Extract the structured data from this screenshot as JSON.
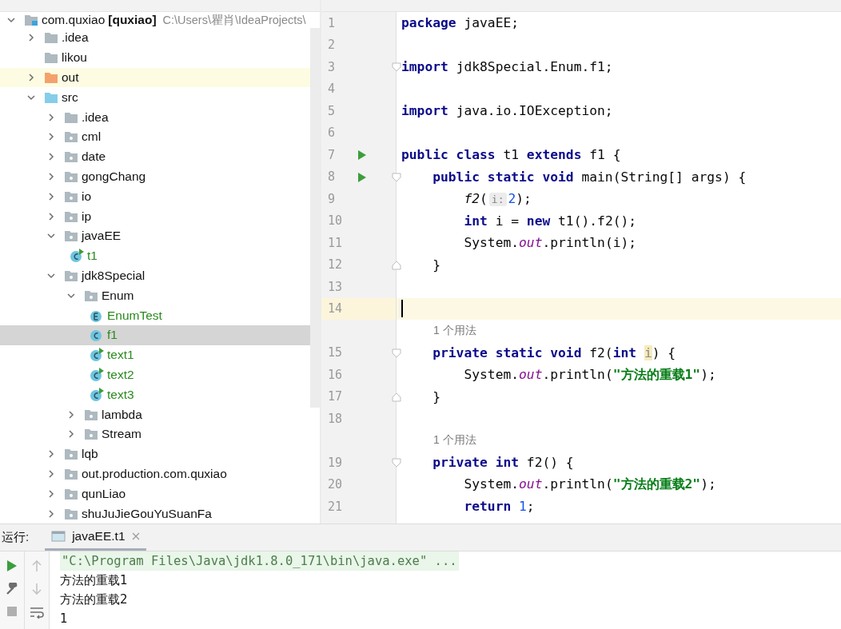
{
  "project_tree": {
    "root": {
      "name": "com.quxiao",
      "module": "[quxiao]",
      "path": "C:\\Users\\瞿肖\\IdeaProjects\\",
      "expanded": true
    },
    "items": [
      {
        "name": ".idea",
        "kind": "folder",
        "expanded": false,
        "selected": false,
        "highlighted": false
      },
      {
        "name": "likou",
        "kind": "plain_folder",
        "selected": false,
        "highlighted": false
      },
      {
        "name": "out",
        "kind": "excluded_folder",
        "expanded": false,
        "selected": false,
        "highlighted": true
      },
      {
        "name": "src",
        "kind": "source_root",
        "expanded": true,
        "selected": false,
        "highlighted": false,
        "children": [
          {
            "name": ".idea",
            "kind": "folder",
            "expanded": false,
            "selected": false,
            "highlighted": false
          },
          {
            "name": "cml",
            "kind": "package",
            "expanded": false,
            "selected": false,
            "highlighted": false
          },
          {
            "name": "date",
            "kind": "package",
            "expanded": false,
            "selected": false,
            "highlighted": false
          },
          {
            "name": "gongChang",
            "kind": "package",
            "expanded": false,
            "selected": false,
            "highlighted": false
          },
          {
            "name": "io",
            "kind": "package",
            "expanded": false,
            "selected": false,
            "highlighted": false
          },
          {
            "name": "ip",
            "kind": "package",
            "expanded": false,
            "selected": false,
            "highlighted": false
          },
          {
            "name": "javaEE",
            "kind": "package",
            "expanded": true,
            "selected": false,
            "highlighted": false,
            "children": [
              {
                "name": "t1",
                "kind": "main_class",
                "selected": false,
                "highlighted": false
              }
            ]
          },
          {
            "name": "jdk8Special",
            "kind": "package",
            "expanded": true,
            "selected": false,
            "highlighted": false,
            "children": [
              {
                "name": "Enum",
                "kind": "package",
                "expanded": true,
                "selected": false,
                "highlighted": false,
                "children": [
                  {
                    "name": "EnumTest",
                    "kind": "enum",
                    "selected": false,
                    "highlighted": false
                  },
                  {
                    "name": "f1",
                    "kind": "class",
                    "selected": true,
                    "highlighted": false
                  },
                  {
                    "name": "text1",
                    "kind": "main_class",
                    "selected": false,
                    "highlighted": false
                  },
                  {
                    "name": "text2",
                    "kind": "main_class",
                    "selected": false,
                    "highlighted": false
                  },
                  {
                    "name": "text3",
                    "kind": "main_class",
                    "selected": false,
                    "highlighted": false
                  }
                ]
              },
              {
                "name": "lambda",
                "kind": "package",
                "expanded": false,
                "selected": false,
                "highlighted": false
              },
              {
                "name": "Stream",
                "kind": "package",
                "expanded": false,
                "selected": false,
                "highlighted": false
              }
            ]
          },
          {
            "name": "lqb",
            "kind": "package",
            "expanded": false,
            "selected": false,
            "highlighted": false
          },
          {
            "name": "out.production.com.quxiao",
            "kind": "package",
            "expanded": false,
            "selected": false,
            "highlighted": false
          },
          {
            "name": "qunLiao",
            "kind": "package",
            "expanded": false,
            "selected": false,
            "highlighted": false
          },
          {
            "name": "shuJuJieGouYuSuanFa",
            "kind": "package",
            "expanded": false,
            "selected": false,
            "highlighted": false
          }
        ]
      }
    ]
  },
  "editor": {
    "rows": [
      {
        "kind": "code",
        "number": "1",
        "current": false,
        "run": false,
        "fold_start": false,
        "fold_end": false,
        "tokens": [
          {
            "kind": "kw",
            "s": "package"
          },
          {
            "kind": "plain",
            "s": " javaEE;"
          }
        ]
      },
      {
        "kind": "code",
        "number": "2",
        "current": false,
        "run": false,
        "fold_start": false,
        "fold_end": false,
        "tokens": []
      },
      {
        "kind": "code",
        "number": "3",
        "current": false,
        "run": false,
        "fold_start": true,
        "fold_end": false,
        "tokens": [
          {
            "kind": "kw",
            "s": "import"
          },
          {
            "kind": "plain",
            "s": " jdk8Special.Enum.f1;"
          }
        ]
      },
      {
        "kind": "code",
        "number": "4",
        "current": false,
        "run": false,
        "fold_start": false,
        "fold_end": false,
        "tokens": []
      },
      {
        "kind": "code",
        "number": "5",
        "current": false,
        "run": false,
        "fold_start": false,
        "fold_end": false,
        "tokens": [
          {
            "kind": "kw",
            "s": "import"
          },
          {
            "kind": "plain",
            "s": " java.io.IOException;"
          }
        ]
      },
      {
        "kind": "code",
        "number": "6",
        "current": false,
        "run": false,
        "fold_start": false,
        "fold_end": false,
        "tokens": []
      },
      {
        "kind": "code",
        "number": "7",
        "current": false,
        "run": true,
        "fold_start": false,
        "fold_end": false,
        "tokens": [
          {
            "kind": "kw",
            "s": "public class"
          },
          {
            "kind": "plain",
            "s": " t1 "
          },
          {
            "kind": "kw",
            "s": "extends"
          },
          {
            "kind": "plain",
            "s": " f1 {"
          }
        ]
      },
      {
        "kind": "code",
        "number": "8",
        "current": false,
        "run": true,
        "fold_start": true,
        "fold_end": false,
        "tokens": [
          {
            "kind": "kw",
            "s": "    public static void"
          },
          {
            "kind": "plain",
            "s": " main(String[] args) {"
          }
        ]
      },
      {
        "kind": "code",
        "number": "9",
        "current": false,
        "run": false,
        "fold_start": false,
        "fold_end": false,
        "tokens": [
          {
            "kind": "call",
            "s": "        f2"
          },
          {
            "kind": "plain",
            "s": "("
          },
          {
            "kind": "hint",
            "s": "i:"
          },
          {
            "kind": "num",
            "s": "2"
          },
          {
            "kind": "plain",
            "s": ");"
          }
        ]
      },
      {
        "kind": "code",
        "number": "10",
        "current": false,
        "run": false,
        "fold_start": false,
        "fold_end": false,
        "tokens": [
          {
            "kind": "kw",
            "s": "        int"
          },
          {
            "kind": "plain",
            "s": " i = "
          },
          {
            "kind": "kw",
            "s": "new"
          },
          {
            "kind": "plain",
            "s": " t1().f2();"
          }
        ]
      },
      {
        "kind": "code",
        "number": "11",
        "current": false,
        "run": false,
        "fold_start": false,
        "fold_end": false,
        "tokens": [
          {
            "kind": "plain",
            "s": "        System."
          },
          {
            "kind": "field",
            "s": "out"
          },
          {
            "kind": "plain",
            "s": ".println(i);"
          }
        ]
      },
      {
        "kind": "code",
        "number": "12",
        "current": false,
        "run": false,
        "fold_start": false,
        "fold_end": true,
        "tokens": [
          {
            "kind": "plain",
            "s": "    }"
          }
        ]
      },
      {
        "kind": "code",
        "number": "13",
        "current": false,
        "run": false,
        "fold_start": false,
        "fold_end": false,
        "tokens": []
      },
      {
        "kind": "code",
        "number": "14",
        "current": true,
        "run": false,
        "fold_start": false,
        "fold_end": false,
        "tokens": []
      },
      {
        "kind": "hint",
        "text": "1 个用法"
      },
      {
        "kind": "code",
        "number": "15",
        "current": false,
        "run": false,
        "fold_start": true,
        "fold_end": false,
        "tokens": [
          {
            "kind": "kw",
            "s": "    private static void"
          },
          {
            "kind": "plain",
            "s": " f2("
          },
          {
            "kind": "kw",
            "s": "int "
          },
          {
            "kind": "unused",
            "s": "i"
          },
          {
            "kind": "plain",
            "s": ") {"
          }
        ]
      },
      {
        "kind": "code",
        "number": "16",
        "current": false,
        "run": false,
        "fold_start": false,
        "fold_end": false,
        "tokens": [
          {
            "kind": "plain",
            "s": "        System."
          },
          {
            "kind": "field",
            "s": "out"
          },
          {
            "kind": "plain",
            "s": ".println("
          },
          {
            "kind": "str",
            "s": "\"方法的重载1\""
          },
          {
            "kind": "plain",
            "s": ");"
          }
        ]
      },
      {
        "kind": "code",
        "number": "17",
        "current": false,
        "run": false,
        "fold_start": false,
        "fold_end": true,
        "tokens": [
          {
            "kind": "plain",
            "s": "    }"
          }
        ]
      },
      {
        "kind": "code",
        "number": "18",
        "current": false,
        "run": false,
        "fold_start": false,
        "fold_end": false,
        "tokens": []
      },
      {
        "kind": "hint",
        "text": "1 个用法"
      },
      {
        "kind": "code",
        "number": "19",
        "current": false,
        "run": false,
        "fold_start": true,
        "fold_end": false,
        "tokens": [
          {
            "kind": "kw",
            "s": "    private int"
          },
          {
            "kind": "plain",
            "s": " f2() {"
          }
        ]
      },
      {
        "kind": "code",
        "number": "20",
        "current": false,
        "run": false,
        "fold_start": false,
        "fold_end": false,
        "tokens": [
          {
            "kind": "plain",
            "s": "        System."
          },
          {
            "kind": "field",
            "s": "out"
          },
          {
            "kind": "plain",
            "s": ".println("
          },
          {
            "kind": "str",
            "s": "\"方法的重载2\""
          },
          {
            "kind": "plain",
            "s": ");"
          }
        ]
      },
      {
        "kind": "code",
        "number": "21",
        "current": false,
        "run": false,
        "fold_start": false,
        "fold_end": false,
        "tokens": [
          {
            "kind": "kw",
            "s": "        return "
          },
          {
            "kind": "num",
            "s": "1"
          },
          {
            "kind": "plain",
            "s": ";"
          }
        ]
      }
    ]
  },
  "run_panel": {
    "label": "运行:",
    "tab": {
      "label": "javaEE.t1",
      "selected": true
    },
    "lines": [
      {
        "kind": "command",
        "text": "\"C:\\Program Files\\Java\\jdk1.8.0_171\\bin\\java.exe\" ..."
      },
      {
        "kind": "output",
        "text": "方法的重载1"
      },
      {
        "kind": "output",
        "text": "方法的重载2"
      },
      {
        "kind": "output",
        "text": "1"
      }
    ]
  }
}
